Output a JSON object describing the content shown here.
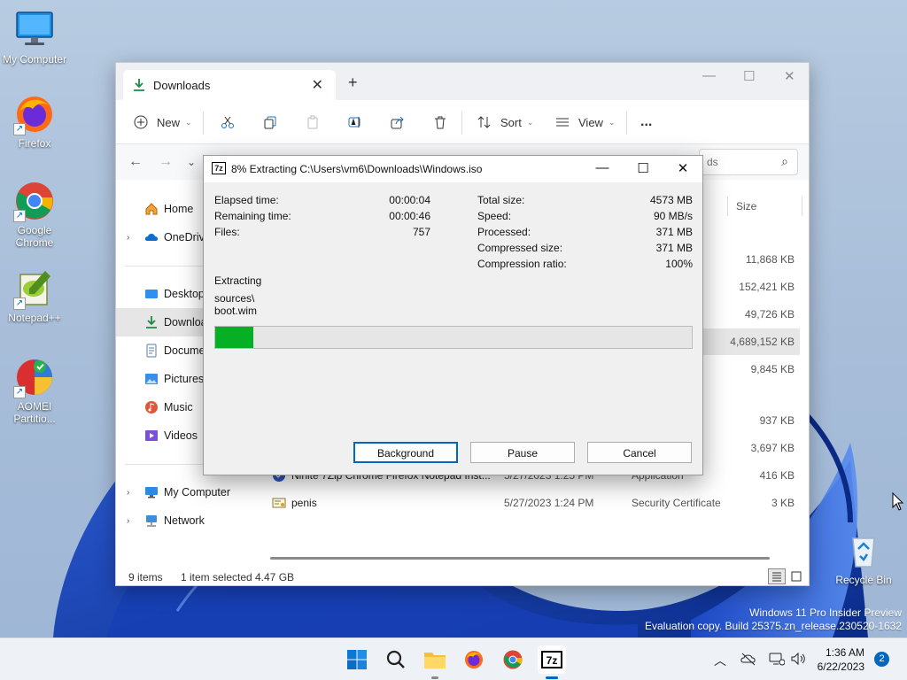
{
  "desktop": {
    "icons": [
      {
        "label": "My Computer"
      },
      {
        "label": "Firefox"
      },
      {
        "label": "Google Chrome"
      },
      {
        "label": "Notepad++"
      },
      {
        "label": "AOMEI Partitio..."
      },
      {
        "label": "Recycle Bin"
      }
    ],
    "watermark": {
      "line1": "Windows 11 Pro Insider Preview",
      "line2": "Evaluation copy. Build 25375.zn_release.230520-1632"
    }
  },
  "explorer": {
    "tab_title": "Downloads",
    "toolbar": {
      "new_label": "New",
      "sort_label": "Sort",
      "view_label": "View",
      "more_label": "..."
    },
    "search_placeholder": "ds",
    "nav": [
      {
        "label": "Home"
      },
      {
        "label": "OneDrive"
      },
      {
        "label": "Desktop"
      },
      {
        "label": "Downloads"
      },
      {
        "label": "Documents"
      },
      {
        "label": "Pictures"
      },
      {
        "label": "Music"
      },
      {
        "label": "Videos"
      },
      {
        "label": "My Computer"
      },
      {
        "label": "Network"
      }
    ],
    "columns": {
      "size": "Size"
    },
    "rows": [
      {
        "size": "11,868 KB"
      },
      {
        "size": "152,421 KB"
      },
      {
        "size": "49,726 KB"
      },
      {
        "size": "4,689,152 KB"
      },
      {
        "size": "9,845 KB"
      },
      {
        "size": "937 KB"
      },
      {
        "size": "3,697 KB"
      },
      {
        "name": "Ninite 7Zip Chrome Firefox Notepad Inst...",
        "date": "5/27/2023 1:25 PM",
        "type": "Application",
        "size": "416 KB"
      },
      {
        "name": "penis",
        "date": "5/27/2023 1:24 PM",
        "type": "Security Certificate",
        "size": "3 KB"
      }
    ],
    "status": {
      "items": "9 items",
      "selected": "1 item selected",
      "selected_size": "4.47 GB"
    }
  },
  "dialog": {
    "title": "8% Extracting C:\\Users\\vm6\\Downloads\\Windows.iso",
    "logo": "7z",
    "left_stats": [
      {
        "label": "Elapsed time:",
        "value": "00:00:04"
      },
      {
        "label": "Remaining time:",
        "value": "00:00:46"
      },
      {
        "label": "Files:",
        "value": "757"
      }
    ],
    "right_stats": [
      {
        "label": "Total size:",
        "value": "4573 MB"
      },
      {
        "label": "Speed:",
        "value": "90 MB/s"
      },
      {
        "label": "Processed:",
        "value": "371 MB"
      },
      {
        "label": "Compressed size:",
        "value": "371 MB"
      },
      {
        "label": "Compression ratio:",
        "value": "100%"
      }
    ],
    "status_label": "Extracting",
    "current_path": "sources\\",
    "current_file": "boot.wim",
    "progress_fraction": 0.08,
    "buttons": {
      "background": "Background",
      "pause": "Pause",
      "cancel": "Cancel"
    }
  },
  "taskbar": {
    "time": "1:36 AM",
    "date": "6/22/2023",
    "notification_count": "2"
  },
  "colors": {
    "progress": "#06b025",
    "accent": "#0067c0"
  }
}
